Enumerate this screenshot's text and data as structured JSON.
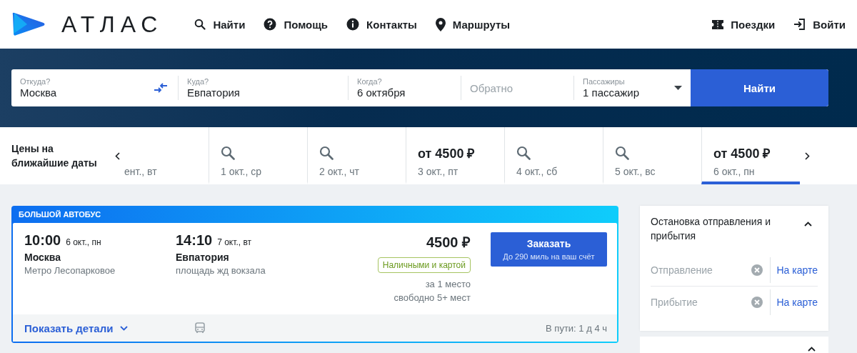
{
  "header": {
    "logo": "АТЛАС",
    "nav": [
      {
        "label": "Найти"
      },
      {
        "label": "Помощь"
      },
      {
        "label": "Контакты"
      },
      {
        "label": "Маршруты"
      }
    ],
    "user_nav": [
      {
        "label": "Поездки"
      },
      {
        "label": "Войти"
      }
    ]
  },
  "search": {
    "fields": [
      {
        "label": "Откуда?",
        "value": "Москва"
      },
      {
        "label": "Куда?",
        "value": "Евпатория"
      },
      {
        "label": "Когда?",
        "value": "6 октября"
      },
      {
        "placeholder": "Обратно"
      },
      {
        "label": "Пассажиры",
        "value": "1 пассажир"
      }
    ],
    "button": "Найти"
  },
  "dates": {
    "title": "Цены на ближайшие даты",
    "items": [
      {
        "kind": "partial",
        "date": "ент., вт",
        "selected": false
      },
      {
        "kind": "search",
        "date": "1 окт., ср",
        "selected": false
      },
      {
        "kind": "search",
        "date": "2 окт., чт",
        "selected": false
      },
      {
        "kind": "price",
        "price": "от 4500 ₽",
        "date": "3 окт., пт",
        "selected": false
      },
      {
        "kind": "search",
        "date": "4 окт., сб",
        "selected": false
      },
      {
        "kind": "search",
        "date": "5 окт., вс",
        "selected": false
      },
      {
        "kind": "price",
        "price": "от 4500 ₽",
        "date": "6 окт., пн",
        "selected": true
      }
    ]
  },
  "trip": {
    "bus_type": "БОЛЬШОЙ АВТОБУС",
    "departure": {
      "time": "10:00",
      "date": "6 окт., пн",
      "city": "Москва",
      "stop": "Метро Лесопарковое"
    },
    "arrival": {
      "time": "14:10",
      "date": "7 окт., вт",
      "city": "Евпатория",
      "stop": "площадь жд вокзала"
    },
    "price": "4500 ₽",
    "payment": "Наличными и картой",
    "per_seat": "за 1 место",
    "seats": "свободно 5+ мест",
    "book_button": {
      "label": "Заказать",
      "note": "До 290 миль на ваш счёт"
    },
    "details_link": "Показать детали",
    "duration": "В пути: 1 д 4 ч"
  },
  "filter": {
    "title": "Остановка отправления и прибытия",
    "expanded": true,
    "fields": [
      {
        "placeholder": "Отправление",
        "link": "На карте"
      },
      {
        "placeholder": "Прибытие",
        "link": "На карте"
      }
    ]
  }
}
